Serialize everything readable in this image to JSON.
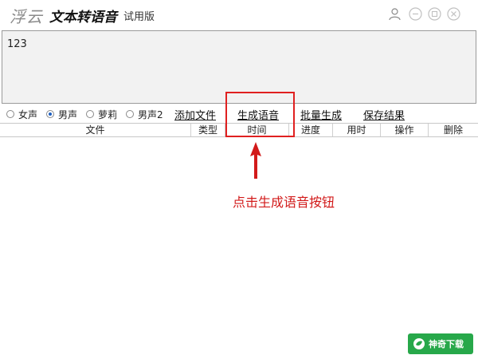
{
  "app": {
    "brand": "浮云",
    "title": "文本转语音",
    "edition": "试用版"
  },
  "text_input": {
    "value": "123"
  },
  "voices": {
    "options": [
      "女声",
      "男声",
      "萝莉",
      "男声2"
    ],
    "selected": "男声"
  },
  "toolbar": {
    "add_file": "添加文件",
    "generate_speech": "生成语音",
    "batch_generate": "批量生成",
    "save_result": "保存结果"
  },
  "table": {
    "columns": [
      "文件",
      "类型",
      "时间",
      "进度",
      "用时",
      "操作",
      "删除"
    ],
    "rows": []
  },
  "annotation": {
    "text": "点击生成语音按钮"
  },
  "watermark": {
    "text": "神奇下载",
    "color": "#27a84a"
  },
  "colors": {
    "highlight": "#e02020",
    "annotation": "#d21a1a",
    "text_area_bg": "#f2f2f2"
  },
  "icons": [
    "user-icon",
    "minimize-icon",
    "restore-icon",
    "close-icon"
  ]
}
